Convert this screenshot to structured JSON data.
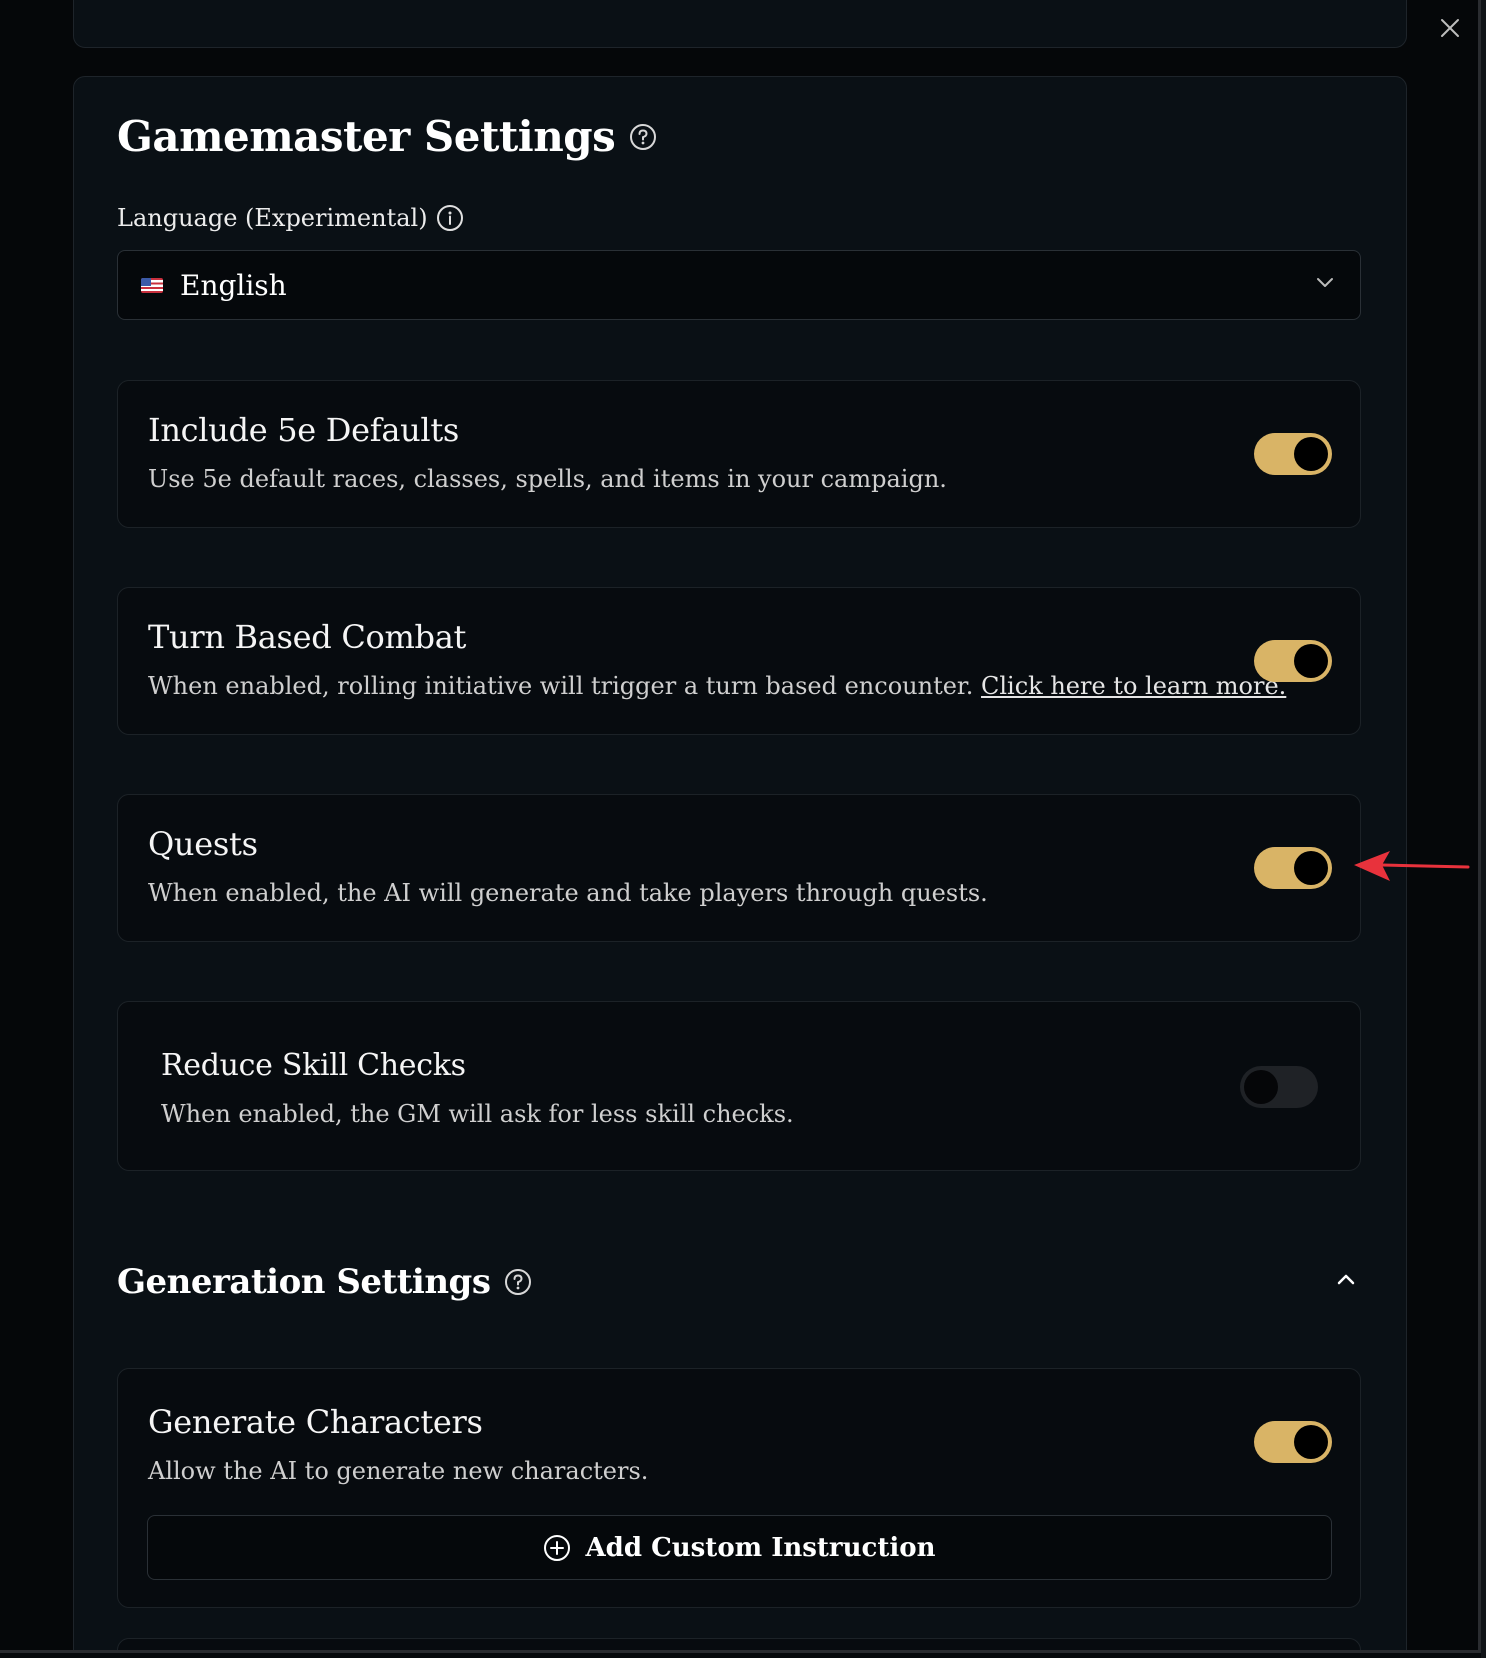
{
  "gamemaster": {
    "title": "Gamemaster Settings",
    "language_label": "Language (Experimental)",
    "language_value": "English"
  },
  "settings": [
    {
      "title": "Include 5e Defaults",
      "description": "Use 5e default races, classes, spells, and items in your campaign.",
      "enabled": true
    },
    {
      "title": "Turn Based Combat",
      "description": "When enabled, rolling initiative will trigger a turn based encounter.",
      "link_text": "Click here to learn more.",
      "enabled": true
    },
    {
      "title": "Quests",
      "description": "When enabled, the AI will generate and take players through quests.",
      "enabled": true
    },
    {
      "title": "Reduce Skill Checks",
      "description": "When enabled, the GM will ask for less skill checks.",
      "enabled": false
    }
  ],
  "generation": {
    "title": "Generation Settings",
    "generate_characters": {
      "title": "Generate Characters",
      "description": "Allow the AI to generate new characters.",
      "enabled": true
    },
    "add_instruction_label": "Add Custom Instruction"
  },
  "colors": {
    "accent": "#d9b466",
    "background": "#0a1015",
    "annotation_arrow": "#e8323c"
  }
}
